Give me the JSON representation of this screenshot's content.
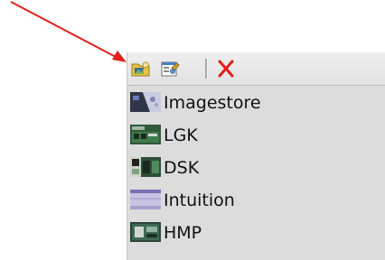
{
  "toolbar": {
    "buttons": [
      {
        "name": "folder-image-icon"
      },
      {
        "name": "properties-icon"
      },
      {
        "name": "delete-icon",
        "color": "#e0201c"
      }
    ]
  },
  "menu": {
    "items": [
      {
        "label": "Imagestore",
        "icon": "imagestore-icon"
      },
      {
        "label": "LGK",
        "icon": "lgk-icon"
      },
      {
        "label": "DSK",
        "icon": "dsk-icon"
      },
      {
        "label": "Intuition",
        "icon": "intuition-icon"
      },
      {
        "label": "HMP",
        "icon": "hmp-icon"
      }
    ]
  },
  "colors": {
    "annotation_arrow": "#e0201c",
    "panel_background": "#dcdcdc"
  }
}
